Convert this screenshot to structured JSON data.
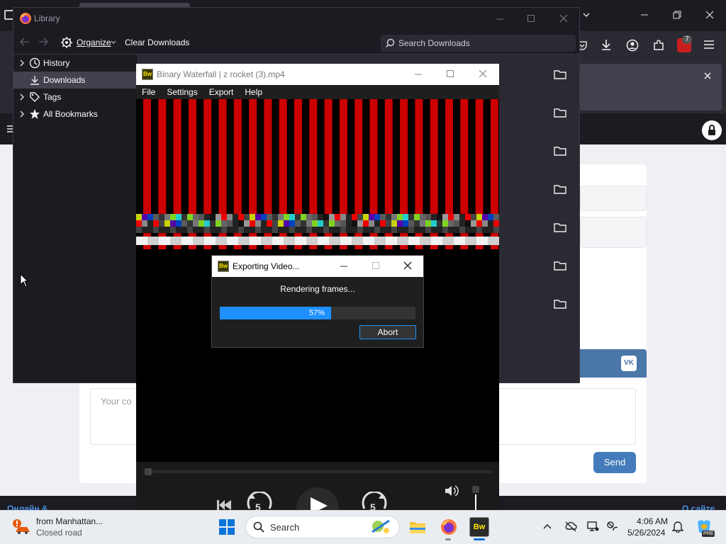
{
  "library": {
    "title": "Library",
    "organize_label": "Organize",
    "clear_downloads_label": "Clear Downloads",
    "search_placeholder": "Search Downloads",
    "tree": [
      {
        "label": "History"
      },
      {
        "label": "Downloads"
      },
      {
        "label": "Tags"
      },
      {
        "label": "All Bookmarks"
      }
    ]
  },
  "binary_waterfall": {
    "title": "Binary Waterfall | z rocket (3).mp4",
    "logo_text": "Bw",
    "menu": [
      "File",
      "Settings",
      "Export",
      "Help"
    ],
    "skip_label": "5"
  },
  "export_dialog": {
    "title": "Exporting Video...",
    "status": "Rendering frames...",
    "progress": 0.57,
    "progress_label": "57%",
    "abort_label": "Abort"
  },
  "browser": {
    "extension_badge": "7"
  },
  "web": {
    "comment_placeholder": "Your co",
    "send_label": "Send",
    "vk_label": "VK",
    "footer_left": "Онлайн &",
    "footer_right": "О сайте"
  },
  "taskbar": {
    "weather_title": "from Manhattan...",
    "weather_subtitle": "Closed road",
    "search_label": "Search",
    "time": "4:06 AM",
    "date": "5/26/2024",
    "copilot_badge": "PRE"
  },
  "colors": {
    "accent": "#1e90ff",
    "vk": "#4a76a8",
    "send": "#447bba",
    "stripe_red": "#cc0000"
  }
}
